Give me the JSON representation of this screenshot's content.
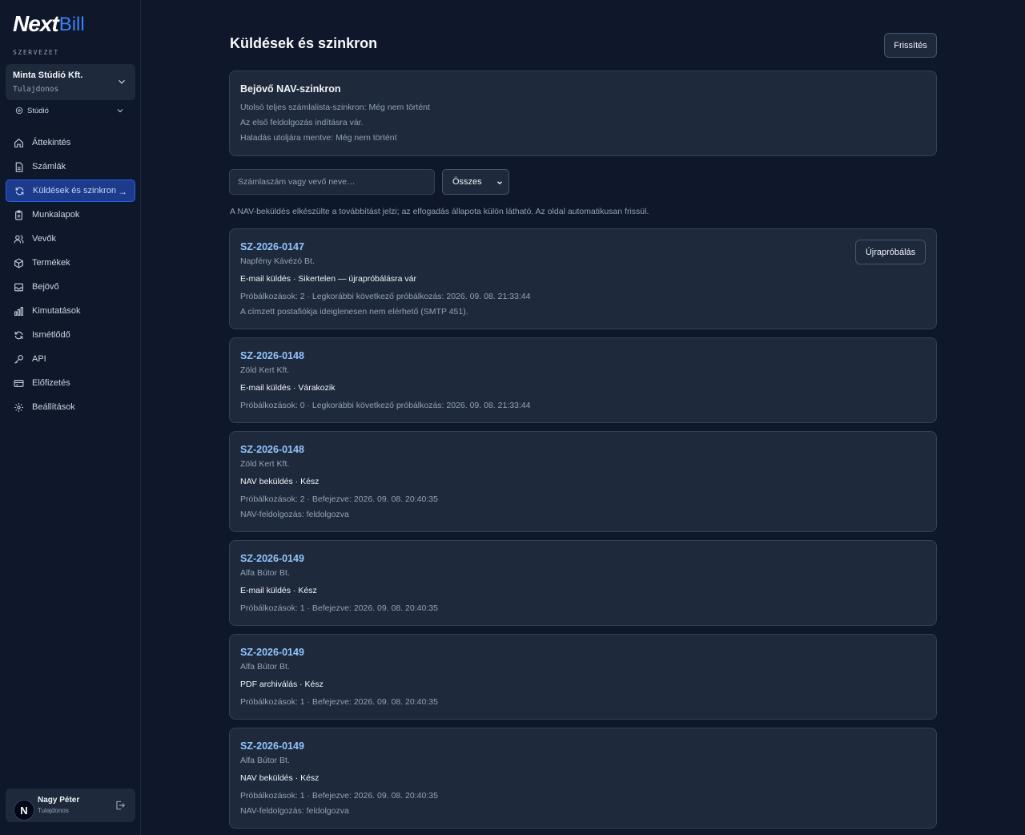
{
  "brand": {
    "part1": "Next",
    "part2": "Bill"
  },
  "sidebar": {
    "section_label": "SZERVEZET",
    "org": {
      "name": "Minta Stúdió Kft.",
      "role": "Tulajdonos"
    },
    "workspace": "Stúdió",
    "items": [
      {
        "label": "Áttekintés",
        "icon": "home-icon"
      },
      {
        "label": "Számlák",
        "icon": "document-icon"
      },
      {
        "label": "Küldések és szinkron",
        "icon": "sync-icon",
        "active": true
      },
      {
        "label": "Munkalapok",
        "icon": "clipboard-icon"
      },
      {
        "label": "Vevők",
        "icon": "users-icon"
      },
      {
        "label": "Termékek",
        "icon": "box-icon"
      },
      {
        "label": "Bejövő",
        "icon": "inbox-icon"
      },
      {
        "label": "Kimutatások",
        "icon": "bar-chart-icon"
      },
      {
        "label": "Ismétlődő",
        "icon": "repeat-icon"
      },
      {
        "label": "API",
        "icon": "key-icon"
      },
      {
        "label": "Előfizetés",
        "icon": "credit-card-icon"
      },
      {
        "label": "Beállítások",
        "icon": "gear-icon"
      }
    ],
    "active_arrow": "→",
    "user": {
      "initial": "N",
      "name": "Nagy Péter",
      "role": "Tulajdonos"
    }
  },
  "main": {
    "title": "Küldések és szinkron",
    "refresh_label": "Frissítés",
    "sync": {
      "title": "Bejövő NAV-szinkron",
      "lines": [
        "Utolsó teljes számlalista-szinkron: Még nem történt",
        "Az első feldolgozás indításra vár.",
        "Haladás utoljára mentve: Még nem történt"
      ]
    },
    "search": {
      "placeholder": "Számlaszám vagy vevő neve…",
      "value": ""
    },
    "filter": {
      "selected": "Összes"
    },
    "hint": "A NAV-beküldés elkészülte a továbbítást jelzi; az elfogadás állapota külön látható. Az oldal automatikusan frissül.",
    "retry_label": "Újrapróbálás",
    "jobs": [
      {
        "id": "SZ-2026-0147",
        "customer": "Napfény Kávézó Bt.",
        "status": "E-mail küldés · Sikertelen — újrapróbálásra vár",
        "meta": "Próbálkozások: 2 · Legkorábbi következő próbálkozás: 2026. 09. 08. 21:33:44",
        "extra": "A címzett postafiókja ideiglenesen nem elérhető (SMTP 451).",
        "retry": true
      },
      {
        "id": "SZ-2026-0148",
        "customer": "Zöld Kert Kft.",
        "status": "E-mail küldés · Várakozik",
        "meta": "Próbálkozások: 0 · Legkorábbi következő próbálkozás: 2026. 09. 08. 21:33:44",
        "extra": ""
      },
      {
        "id": "SZ-2026-0148",
        "customer": "Zöld Kert Kft.",
        "status": "NAV beküldés · Kész",
        "meta": "Próbálkozások: 2 · Befejezve: 2026. 09. 08. 20:40:35",
        "extra": "NAV-feldolgozás: feldolgozva"
      },
      {
        "id": "SZ-2026-0149",
        "customer": "Alfa Bútor Bt.",
        "status": "E-mail küldés · Kész",
        "meta": "Próbálkozások: 1 · Befejezve: 2026. 09. 08. 20:40:35",
        "extra": ""
      },
      {
        "id": "SZ-2026-0149",
        "customer": "Alfa Bútor Bt.",
        "status": "PDF archiválás · Kész",
        "meta": "Próbálkozások: 1 · Befejezve: 2026. 09. 08. 20:40:35",
        "extra": ""
      },
      {
        "id": "SZ-2026-0149",
        "customer": "Alfa Bútor Bt.",
        "status": "NAV beküldés · Kész",
        "meta": "Próbálkozások: 1 · Befejezve: 2026. 09. 08. 20:40:35",
        "extra": "NAV-feldolgozás: feldolgozva"
      }
    ]
  }
}
